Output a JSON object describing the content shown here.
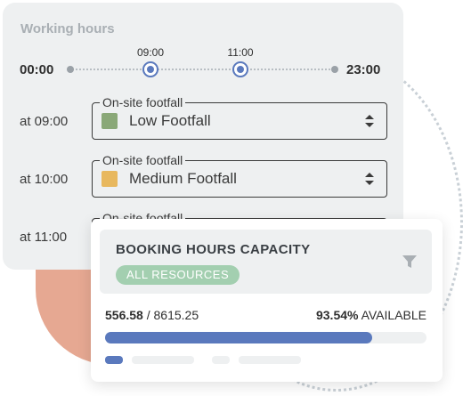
{
  "working_hours": {
    "title": "Working hours",
    "range_start": "00:00",
    "range_end": "23:00",
    "handles": [
      {
        "label": "09:00"
      },
      {
        "label": "11:00"
      }
    ],
    "rows": [
      {
        "time_label": "at 09:00",
        "field_label": "On-site footfall",
        "value": "Low Footfall",
        "swatch_color": "#8aa878"
      },
      {
        "time_label": "at 10:00",
        "field_label": "On-site footfall",
        "value": "Medium Footfall",
        "swatch_color": "#e8b85e"
      },
      {
        "time_label": "at 11:00",
        "field_label": "On-site footfall",
        "value": "",
        "swatch_color": ""
      }
    ]
  },
  "capacity": {
    "title": "BOOKING HOURS CAPACITY",
    "badge": "ALL RESOURCES",
    "used": "556.58",
    "separator": " / ",
    "total": "8615.25",
    "available_percent": "93.54%",
    "available_label": " AVAILABLE",
    "progress_fraction": 0.83,
    "accent_color": "#5a79bd"
  }
}
